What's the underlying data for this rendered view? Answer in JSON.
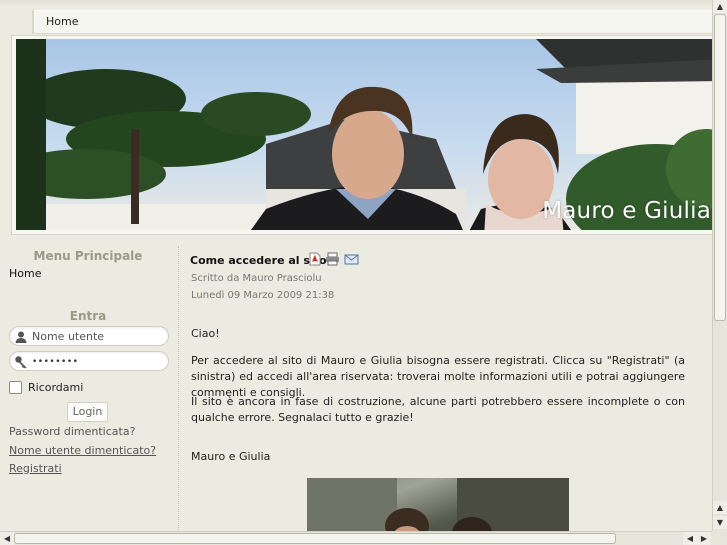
{
  "nav": {
    "home_label": "Home"
  },
  "banner": {
    "title": "Mauro e Giulia"
  },
  "sidebar": {
    "menu_title": "Menu Principale",
    "menu_items": [
      "Home"
    ],
    "login_title": "Entra",
    "username_placeholder": "Nome utente",
    "password_value": "••••••••",
    "remember_label": "Ricordami",
    "login_button": "Login",
    "links": [
      "Password dimenticata?",
      "Nome utente dimenticato?",
      "Registrati"
    ]
  },
  "article": {
    "title": "Come accedere al sito",
    "author": "Scritto da Mauro Prasciolu",
    "date": "Lunedì 09 Marzo 2009 21:38",
    "greeting": "Ciao!",
    "paragraph1": "Per accedere al sito di Mauro e Giulia bisogna essere registrati. Clicca su \"Registrati\" (a sinistra) ed accedi all'area riservata: troverai molte informazioni utili e potrai aggiungere commenti e consigli.",
    "paragraph2": "Il sito è ancora in fase di costruzione, alcune parti potrebbero essere incomplete o con qualche errore. Segnalaci tutto e grazie!",
    "signature": "Mauro e Giulia"
  },
  "icons": [
    "pdf-icon",
    "print-icon",
    "email-icon",
    "user-icon",
    "key-icon"
  ]
}
